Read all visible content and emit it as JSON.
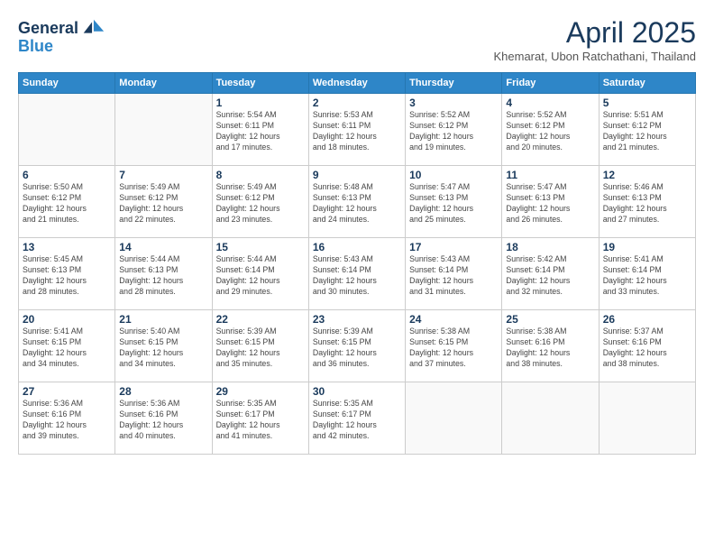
{
  "header": {
    "logo_line1": "General",
    "logo_line2": "Blue",
    "month_title": "April 2025",
    "subtitle": "Khemarat, Ubon Ratchathani, Thailand"
  },
  "weekdays": [
    "Sunday",
    "Monday",
    "Tuesday",
    "Wednesday",
    "Thursday",
    "Friday",
    "Saturday"
  ],
  "weeks": [
    [
      {
        "day": "",
        "info": ""
      },
      {
        "day": "",
        "info": ""
      },
      {
        "day": "1",
        "info": "Sunrise: 5:54 AM\nSunset: 6:11 PM\nDaylight: 12 hours\nand 17 minutes."
      },
      {
        "day": "2",
        "info": "Sunrise: 5:53 AM\nSunset: 6:11 PM\nDaylight: 12 hours\nand 18 minutes."
      },
      {
        "day": "3",
        "info": "Sunrise: 5:52 AM\nSunset: 6:12 PM\nDaylight: 12 hours\nand 19 minutes."
      },
      {
        "day": "4",
        "info": "Sunrise: 5:52 AM\nSunset: 6:12 PM\nDaylight: 12 hours\nand 20 minutes."
      },
      {
        "day": "5",
        "info": "Sunrise: 5:51 AM\nSunset: 6:12 PM\nDaylight: 12 hours\nand 21 minutes."
      }
    ],
    [
      {
        "day": "6",
        "info": "Sunrise: 5:50 AM\nSunset: 6:12 PM\nDaylight: 12 hours\nand 21 minutes."
      },
      {
        "day": "7",
        "info": "Sunrise: 5:49 AM\nSunset: 6:12 PM\nDaylight: 12 hours\nand 22 minutes."
      },
      {
        "day": "8",
        "info": "Sunrise: 5:49 AM\nSunset: 6:12 PM\nDaylight: 12 hours\nand 23 minutes."
      },
      {
        "day": "9",
        "info": "Sunrise: 5:48 AM\nSunset: 6:13 PM\nDaylight: 12 hours\nand 24 minutes."
      },
      {
        "day": "10",
        "info": "Sunrise: 5:47 AM\nSunset: 6:13 PM\nDaylight: 12 hours\nand 25 minutes."
      },
      {
        "day": "11",
        "info": "Sunrise: 5:47 AM\nSunset: 6:13 PM\nDaylight: 12 hours\nand 26 minutes."
      },
      {
        "day": "12",
        "info": "Sunrise: 5:46 AM\nSunset: 6:13 PM\nDaylight: 12 hours\nand 27 minutes."
      }
    ],
    [
      {
        "day": "13",
        "info": "Sunrise: 5:45 AM\nSunset: 6:13 PM\nDaylight: 12 hours\nand 28 minutes."
      },
      {
        "day": "14",
        "info": "Sunrise: 5:44 AM\nSunset: 6:13 PM\nDaylight: 12 hours\nand 28 minutes."
      },
      {
        "day": "15",
        "info": "Sunrise: 5:44 AM\nSunset: 6:14 PM\nDaylight: 12 hours\nand 29 minutes."
      },
      {
        "day": "16",
        "info": "Sunrise: 5:43 AM\nSunset: 6:14 PM\nDaylight: 12 hours\nand 30 minutes."
      },
      {
        "day": "17",
        "info": "Sunrise: 5:43 AM\nSunset: 6:14 PM\nDaylight: 12 hours\nand 31 minutes."
      },
      {
        "day": "18",
        "info": "Sunrise: 5:42 AM\nSunset: 6:14 PM\nDaylight: 12 hours\nand 32 minutes."
      },
      {
        "day": "19",
        "info": "Sunrise: 5:41 AM\nSunset: 6:14 PM\nDaylight: 12 hours\nand 33 minutes."
      }
    ],
    [
      {
        "day": "20",
        "info": "Sunrise: 5:41 AM\nSunset: 6:15 PM\nDaylight: 12 hours\nand 34 minutes."
      },
      {
        "day": "21",
        "info": "Sunrise: 5:40 AM\nSunset: 6:15 PM\nDaylight: 12 hours\nand 34 minutes."
      },
      {
        "day": "22",
        "info": "Sunrise: 5:39 AM\nSunset: 6:15 PM\nDaylight: 12 hours\nand 35 minutes."
      },
      {
        "day": "23",
        "info": "Sunrise: 5:39 AM\nSunset: 6:15 PM\nDaylight: 12 hours\nand 36 minutes."
      },
      {
        "day": "24",
        "info": "Sunrise: 5:38 AM\nSunset: 6:15 PM\nDaylight: 12 hours\nand 37 minutes."
      },
      {
        "day": "25",
        "info": "Sunrise: 5:38 AM\nSunset: 6:16 PM\nDaylight: 12 hours\nand 38 minutes."
      },
      {
        "day": "26",
        "info": "Sunrise: 5:37 AM\nSunset: 6:16 PM\nDaylight: 12 hours\nand 38 minutes."
      }
    ],
    [
      {
        "day": "27",
        "info": "Sunrise: 5:36 AM\nSunset: 6:16 PM\nDaylight: 12 hours\nand 39 minutes."
      },
      {
        "day": "28",
        "info": "Sunrise: 5:36 AM\nSunset: 6:16 PM\nDaylight: 12 hours\nand 40 minutes."
      },
      {
        "day": "29",
        "info": "Sunrise: 5:35 AM\nSunset: 6:17 PM\nDaylight: 12 hours\nand 41 minutes."
      },
      {
        "day": "30",
        "info": "Sunrise: 5:35 AM\nSunset: 6:17 PM\nDaylight: 12 hours\nand 42 minutes."
      },
      {
        "day": "",
        "info": ""
      },
      {
        "day": "",
        "info": ""
      },
      {
        "day": "",
        "info": ""
      }
    ]
  ]
}
